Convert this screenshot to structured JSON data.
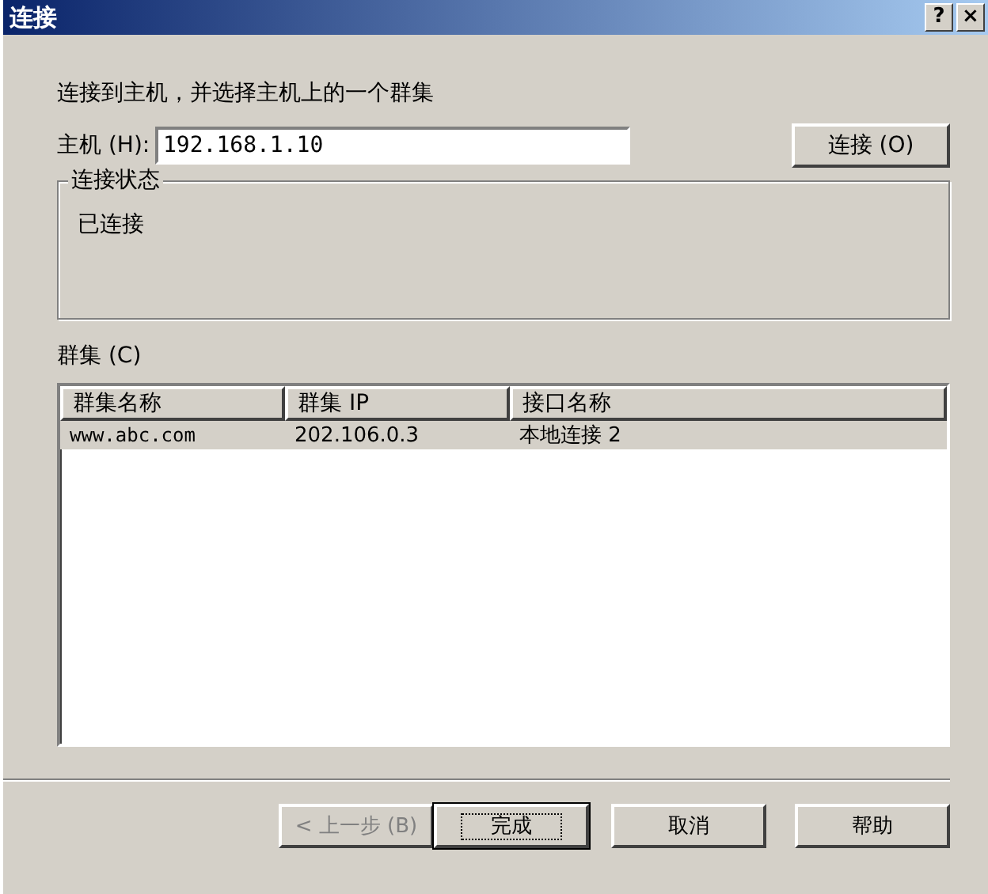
{
  "window": {
    "title": "连接",
    "title_buttons": [
      "?",
      "×"
    ]
  },
  "instruction": "连接到主机，并选择主机上的一个群集",
  "host": {
    "label": "主机 (H):",
    "value": "192.168.1.10",
    "button": "连接 (O)"
  },
  "status_group": {
    "title": "连接状态",
    "text": "已连接"
  },
  "cluster": {
    "label": "群集 (C)",
    "columns": [
      "群集名称",
      "群集 IP",
      "接口名称"
    ],
    "rows": [
      {
        "cells": [
          "www.abc.com",
          "202.106.0.3",
          "本地连接 2"
        ],
        "selected": true
      }
    ]
  },
  "buttons": [
    {
      "label": "< 上一步 (B)",
      "disabled": true,
      "default": false
    },
    {
      "label": "完成",
      "disabled": false,
      "default": true
    },
    {
      "label": "取消",
      "disabled": false,
      "default": false
    },
    {
      "label": "帮助",
      "disabled": false,
      "default": false
    }
  ]
}
